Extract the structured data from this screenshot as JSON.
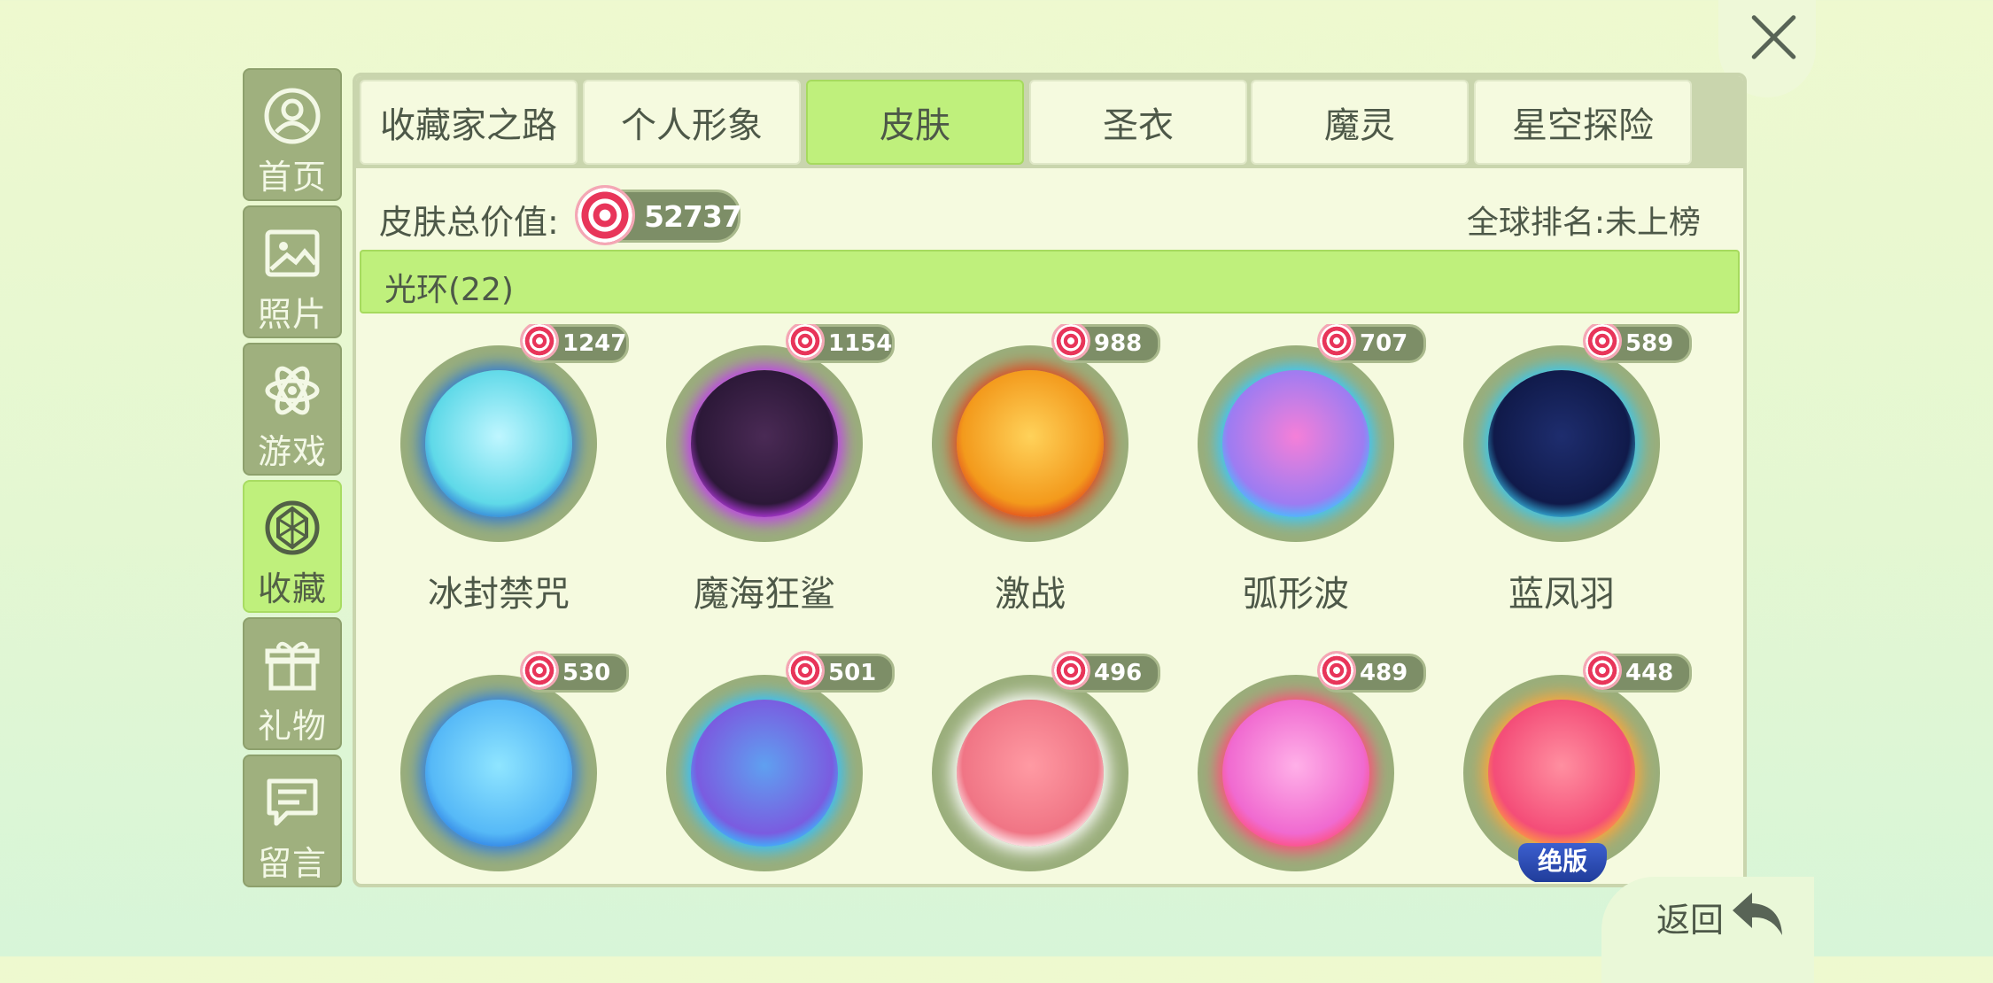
{
  "close_icon": "close-icon",
  "sidebar": {
    "items": [
      {
        "label": "首页",
        "icon": "user-icon",
        "active": false
      },
      {
        "label": "照片",
        "icon": "image-icon",
        "active": false
      },
      {
        "label": "游戏",
        "icon": "atom-icon",
        "active": false
      },
      {
        "label": "收藏",
        "icon": "gem-icon",
        "active": true
      },
      {
        "label": "礼物",
        "icon": "gift-icon",
        "active": false
      },
      {
        "label": "留言",
        "icon": "message-icon",
        "active": false
      }
    ]
  },
  "tabs": [
    {
      "label": "收藏家之路",
      "active": false
    },
    {
      "label": "个人形象",
      "active": false
    },
    {
      "label": "皮肤",
      "active": true
    },
    {
      "label": "圣衣",
      "active": false
    },
    {
      "label": "魔灵",
      "active": false
    },
    {
      "label": "星空探险",
      "active": false
    }
  ],
  "summary": {
    "total_label": "皮肤总价值:",
    "total_value": "52737",
    "rank_label": "全球排名:",
    "rank_value": "未上榜"
  },
  "section": {
    "title": "光环(22)"
  },
  "items": [
    {
      "name": "冰封禁咒",
      "price": "1247",
      "colors": [
        "#bff6ff",
        "#5fd9e8",
        "#2f7bd6"
      ]
    },
    {
      "name": "魔海狂鲨",
      "price": "1154",
      "colors": [
        "#4a2a55",
        "#2c1838",
        "#c23cf0"
      ]
    },
    {
      "name": "激战",
      "price": "988",
      "colors": [
        "#ffd25a",
        "#f39a1c",
        "#e0471f"
      ]
    },
    {
      "name": "弧形波",
      "price": "707",
      "colors": [
        "#f57fd8",
        "#9d7cf2",
        "#3ac8ff"
      ]
    },
    {
      "name": "蓝凤羽",
      "price": "589",
      "colors": [
        "#1e2d6e",
        "#101a4a",
        "#39c7f0"
      ]
    },
    {
      "name": "",
      "price": "530",
      "colors": [
        "#8fe5ff",
        "#56b9f7",
        "#2e7fe3"
      ]
    },
    {
      "name": "",
      "price": "501",
      "colors": [
        "#5fa0f0",
        "#7a5ce0",
        "#34c1ff"
      ]
    },
    {
      "name": "",
      "price": "496",
      "colors": [
        "#ff9aa3",
        "#f07585",
        "#ffffff"
      ]
    },
    {
      "name": "",
      "price": "489",
      "colors": [
        "#ffb0e8",
        "#f06ad0",
        "#ff4e7a"
      ]
    },
    {
      "name": "",
      "price": "448",
      "colors": [
        "#ff8fa0",
        "#f44d78",
        "#ffa53a"
      ],
      "badge": "绝版"
    }
  ],
  "back": {
    "label": "返回",
    "icon": "back-arrow-icon"
  }
}
